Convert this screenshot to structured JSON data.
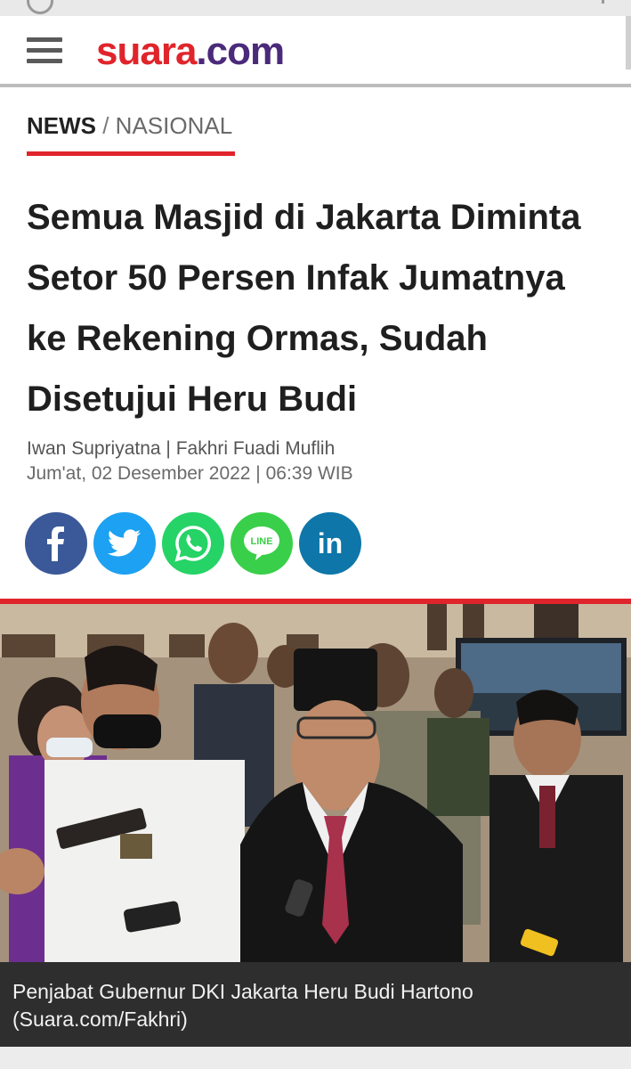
{
  "header": {
    "menu_icon": "hamburger-menu-icon",
    "logo_part1": "suara",
    "logo_part2": ".com"
  },
  "breadcrumb": {
    "section": "NEWS",
    "separator": " / ",
    "subsection": "NASIONAL"
  },
  "article": {
    "title": "Semua Masjid di Jakarta Diminta Setor 50 Persen Infak Jumatnya ke Rekening Ormas, Sudah Disetujui Heru Budi",
    "authors": "Iwan Supriyatna | Fakhri Fuadi Muflih",
    "date": "Jum'at, 02 Desember 2022 | 06:39 WIB"
  },
  "share": {
    "buttons": [
      {
        "icon": "facebook-icon",
        "color": "#3b5998"
      },
      {
        "icon": "twitter-icon",
        "color": "#1da1f2"
      },
      {
        "icon": "whatsapp-icon",
        "color": "#25d366"
      },
      {
        "icon": "line-icon",
        "color": "#3acf4a",
        "text": "LINE"
      },
      {
        "icon": "linkedin-icon",
        "color": "#0e76a8",
        "text": "in"
      }
    ]
  },
  "photo": {
    "caption": "Penjabat Gubernur DKI Jakarta Heru Budi Hartono (Suara.com/Fakhri)"
  },
  "colors": {
    "brand_red": "#e0242b",
    "brand_purple": "#4b2a7a",
    "caption_bg": "#2e2e2e"
  }
}
